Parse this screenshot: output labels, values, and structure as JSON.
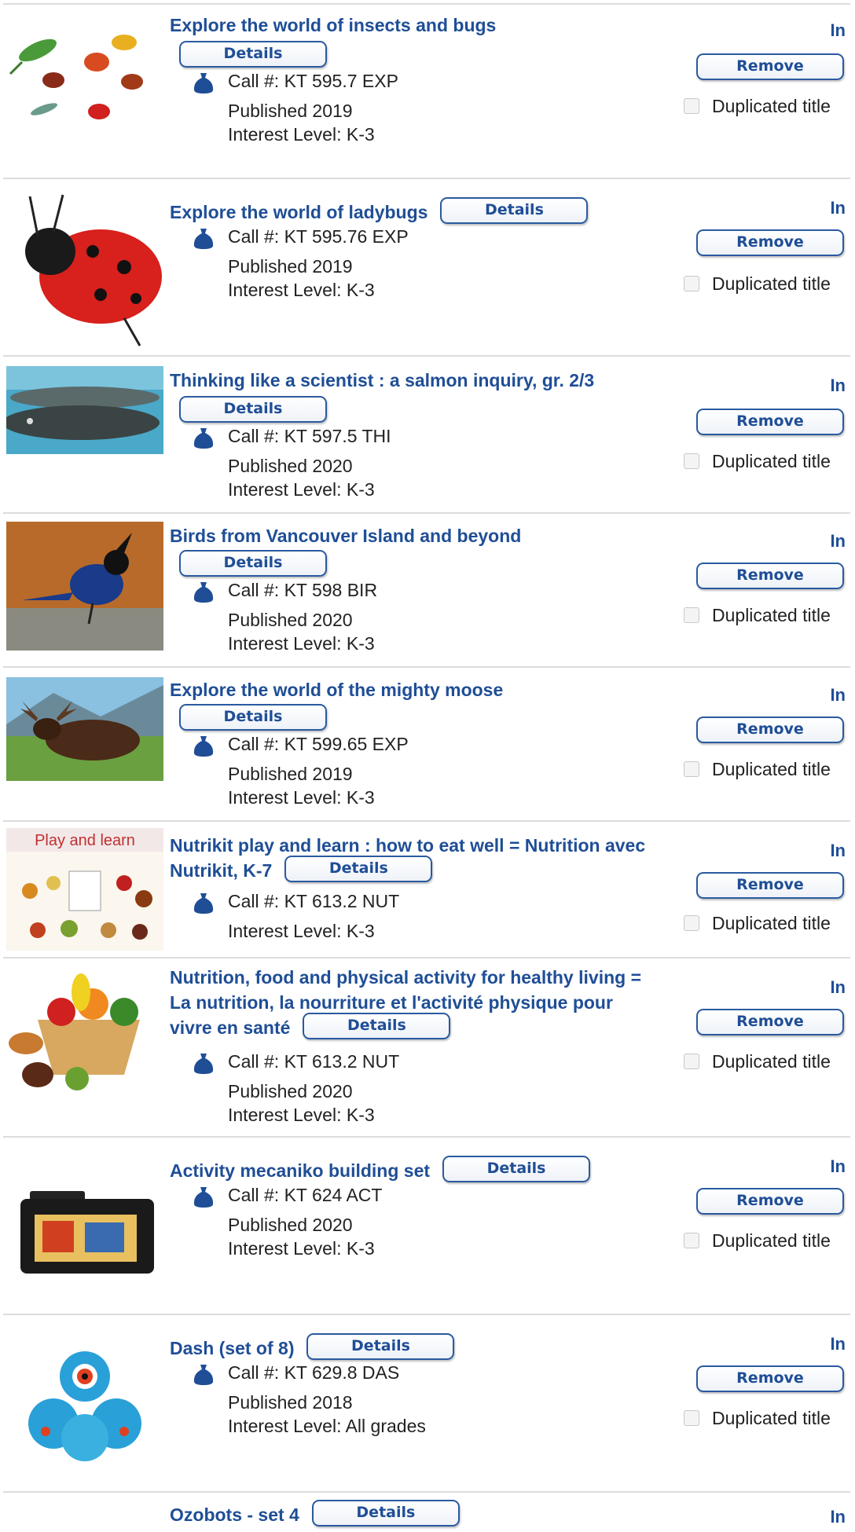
{
  "labels": {
    "details": "Details",
    "remove": "Remove",
    "duplicated": "Duplicated title",
    "status": "In"
  },
  "items": [
    {
      "title": "Explore the world of insects and bugs",
      "call": "Call #: KT 595.7 EXP",
      "published": "Published 2019",
      "interest": "Interest Level: K-3",
      "thumb": "insects-image"
    },
    {
      "title": "Explore the world of ladybugs",
      "call": "Call #: KT 595.76 EXP",
      "published": "Published 2019",
      "interest": "Interest Level: K-3",
      "thumb": "ladybug-image"
    },
    {
      "title": "Thinking like a scientist : a salmon inquiry, gr. 2/3",
      "call": "Call #: KT 597.5 THI",
      "published": "Published 2020",
      "interest": "Interest Level: K-3",
      "thumb": "salmon-image"
    },
    {
      "title": "Birds from Vancouver Island and beyond",
      "call": "Call #: KT 598 BIR",
      "published": "Published 2020",
      "interest": "Interest Level: K-3",
      "thumb": "bird-image"
    },
    {
      "title": "Explore the world of the mighty moose",
      "call": "Call #: KT 599.65 EXP",
      "published": "Published 2019",
      "interest": "Interest Level: K-3",
      "thumb": "moose-image"
    },
    {
      "title": "Nutrikit play and learn : how to eat well = Nutrition avec Nutrikit, K-7",
      "call": "Call #: KT 613.2 NUT",
      "published": "",
      "interest": "Interest Level: K-3",
      "thumb": "nutrikit-image",
      "thumb_text": "Play and learn"
    },
    {
      "title": "Nutrition, food and physical activity for healthy living = La nutrition, la nourriture et l'activité physique pour vivre en santé",
      "call": "Call #: KT 613.2 NUT",
      "published": "Published 2020",
      "interest": "Interest Level: K-3",
      "thumb": "food-basket-image"
    },
    {
      "title": "Activity mecaniko building set",
      "call": "Call #: KT 624 ACT",
      "published": "Published 2020",
      "interest": "Interest Level: K-3",
      "thumb": "building-set-image"
    },
    {
      "title": "Dash (set of 8)",
      "call": "Call #: KT 629.8 DAS",
      "published": "Published 2018",
      "interest": "Interest Level: All grades",
      "thumb": "robot-image"
    },
    {
      "title": "Ozobots - set 4",
      "call": "",
      "published": "",
      "interest": "",
      "thumb": ""
    }
  ]
}
